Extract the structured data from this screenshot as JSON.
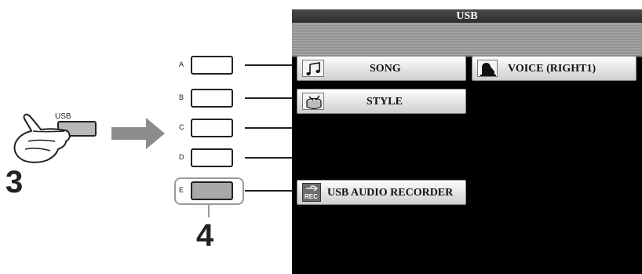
{
  "diagram": {
    "usb_button_label": "USB",
    "step_3": "3",
    "step_4": "4",
    "panel_buttons": [
      "A",
      "B",
      "C",
      "D",
      "E"
    ]
  },
  "screen": {
    "title": "USB",
    "buttons": {
      "song": "SONG",
      "style": "STYLE",
      "voice": "VOICE (RIGHT1)",
      "usb_audio_recorder": "USB AUDIO RECORDER"
    },
    "rec_icon_label": "REC"
  },
  "colors": {
    "screen_bg": "#000000",
    "highlight": "#9a9a9a",
    "arrow": "#8c8c8c"
  }
}
